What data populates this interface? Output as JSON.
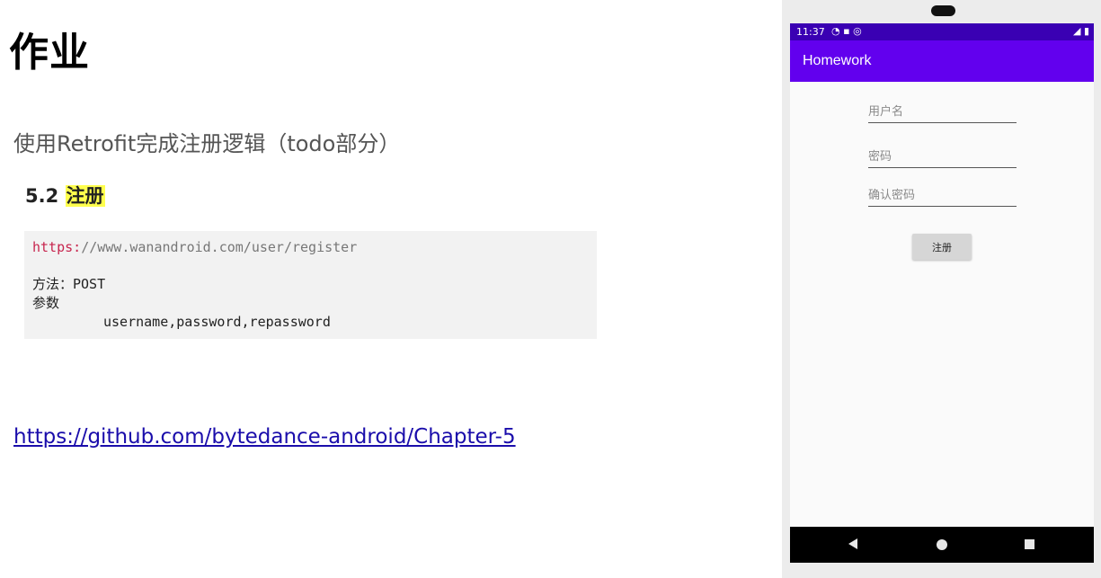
{
  "slide": {
    "title": "作业",
    "subtitle": "使用Retrofit完成注册逻辑（todo部分）",
    "section_number": "5.2",
    "section_title": "注册",
    "code": {
      "url_protocol": "https:",
      "url_rest": "//www.wanandroid.com/user/register",
      "method_line": "方法：POST",
      "params_label": "参数",
      "params_value": "username,password,repassword"
    },
    "link": "https://github.com/bytedance-android/Chapter-5"
  },
  "phone": {
    "status_bar": {
      "time": "11:37",
      "left_icons": [
        "wifi-icon",
        "lock-icon",
        "sync-icon"
      ],
      "right_icons": [
        "wifi-icon",
        "signal-icon",
        "battery-icon"
      ]
    },
    "app_bar": {
      "title": "Homework"
    },
    "form": {
      "username_placeholder": "用户名",
      "password_placeholder": "密码",
      "confirm_placeholder": "确认密码",
      "register_label": "注册"
    },
    "nav": [
      "back-icon",
      "home-icon",
      "recents-icon"
    ]
  },
  "colors": {
    "status_bar": "#3a00b3",
    "app_bar": "#6200ee",
    "highlight": "#ffff4d",
    "link": "#1a0dab",
    "code_protocol": "#c7254e"
  }
}
